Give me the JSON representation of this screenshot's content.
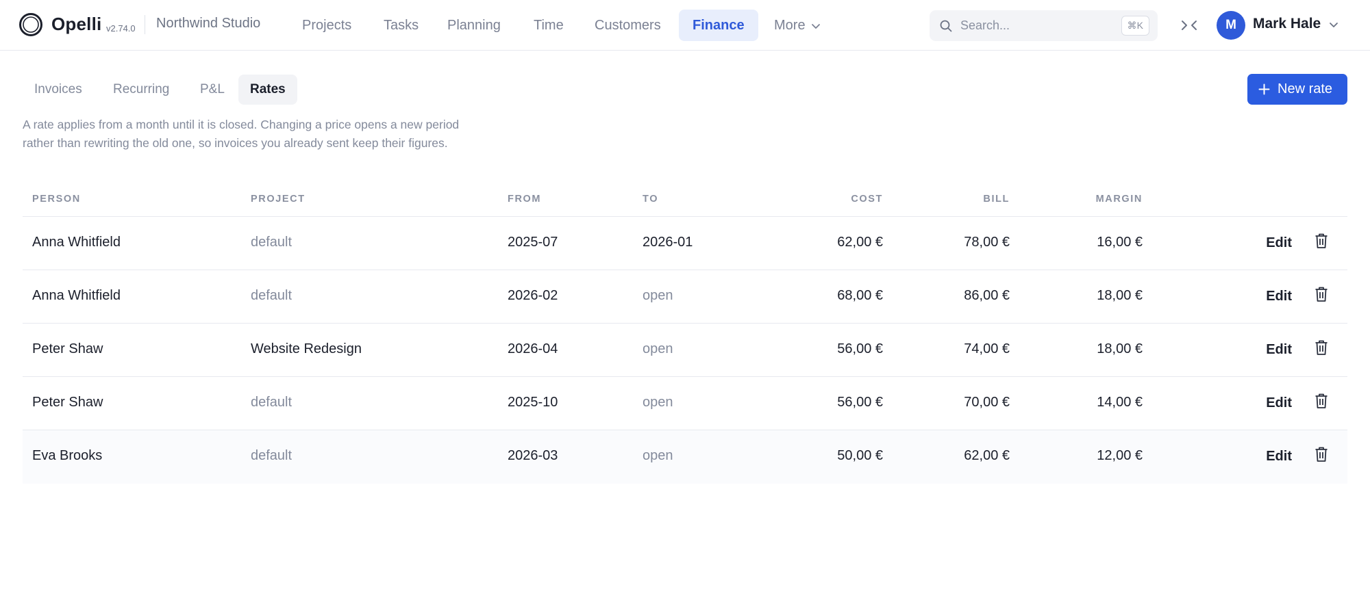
{
  "app": {
    "name": "Opelli",
    "version": "v2.74.0",
    "workspace": "Northwind Studio"
  },
  "nav": {
    "items": [
      {
        "label": "Projects"
      },
      {
        "label": "Tasks"
      },
      {
        "label": "Planning"
      },
      {
        "label": "Time"
      },
      {
        "label": "Customers"
      },
      {
        "label": "Finance",
        "active": true
      },
      {
        "label": "More"
      }
    ]
  },
  "search": {
    "placeholder": "Search...",
    "value": "",
    "shortcut": "⌘K"
  },
  "user": {
    "initial": "M",
    "name": "Mark Hale"
  },
  "subtabs": [
    {
      "label": "Invoices"
    },
    {
      "label": "Recurring"
    },
    {
      "label": "P&L"
    },
    {
      "label": "Rates",
      "active": true
    }
  ],
  "actions": {
    "new_rate_label": "New rate"
  },
  "description": "A rate applies from a month until it is closed. Changing a price opens a new period rather than rewriting the old one, so invoices you already sent keep their figures.",
  "table": {
    "columns": {
      "person": "PERSON",
      "project": "PROJECT",
      "from": "FROM",
      "to": "TO",
      "cost": "COST",
      "bill": "BILL",
      "margin": "MARGIN"
    },
    "edit_label": "Edit",
    "rows": [
      {
        "person": "Anna Whitfield",
        "project": "default",
        "from": "2025-07",
        "to": "2026-01",
        "cost": "62,00 €",
        "bill": "78,00 €",
        "margin": "16,00 €"
      },
      {
        "person": "Anna Whitfield",
        "project": "default",
        "from": "2026-02",
        "to": "open",
        "cost": "68,00 €",
        "bill": "86,00 €",
        "margin": "18,00 €"
      },
      {
        "person": "Peter Shaw",
        "project": "Website Redesign",
        "from": "2026-04",
        "to": "open",
        "cost": "56,00 €",
        "bill": "74,00 €",
        "margin": "18,00 €"
      },
      {
        "person": "Peter Shaw",
        "project": "default",
        "from": "2025-10",
        "to": "open",
        "cost": "56,00 €",
        "bill": "70,00 €",
        "margin": "14,00 €"
      },
      {
        "person": "Eva Brooks",
        "project": "default",
        "from": "2026-03",
        "to": "open",
        "cost": "50,00 €",
        "bill": "62,00 €",
        "margin": "12,00 €"
      }
    ]
  },
  "colors": {
    "accent": "#2b5ce0",
    "active_nav_bg": "#e8eefc",
    "muted_text": "#838a9b",
    "border": "#e7e9ef"
  },
  "icons": {
    "logo": "ring-logo-icon",
    "search": "search-icon",
    "collapse": "collapse-arrows-icon",
    "chevron": "chevron-down-icon",
    "plus": "plus-icon",
    "delete": "trash-icon"
  }
}
